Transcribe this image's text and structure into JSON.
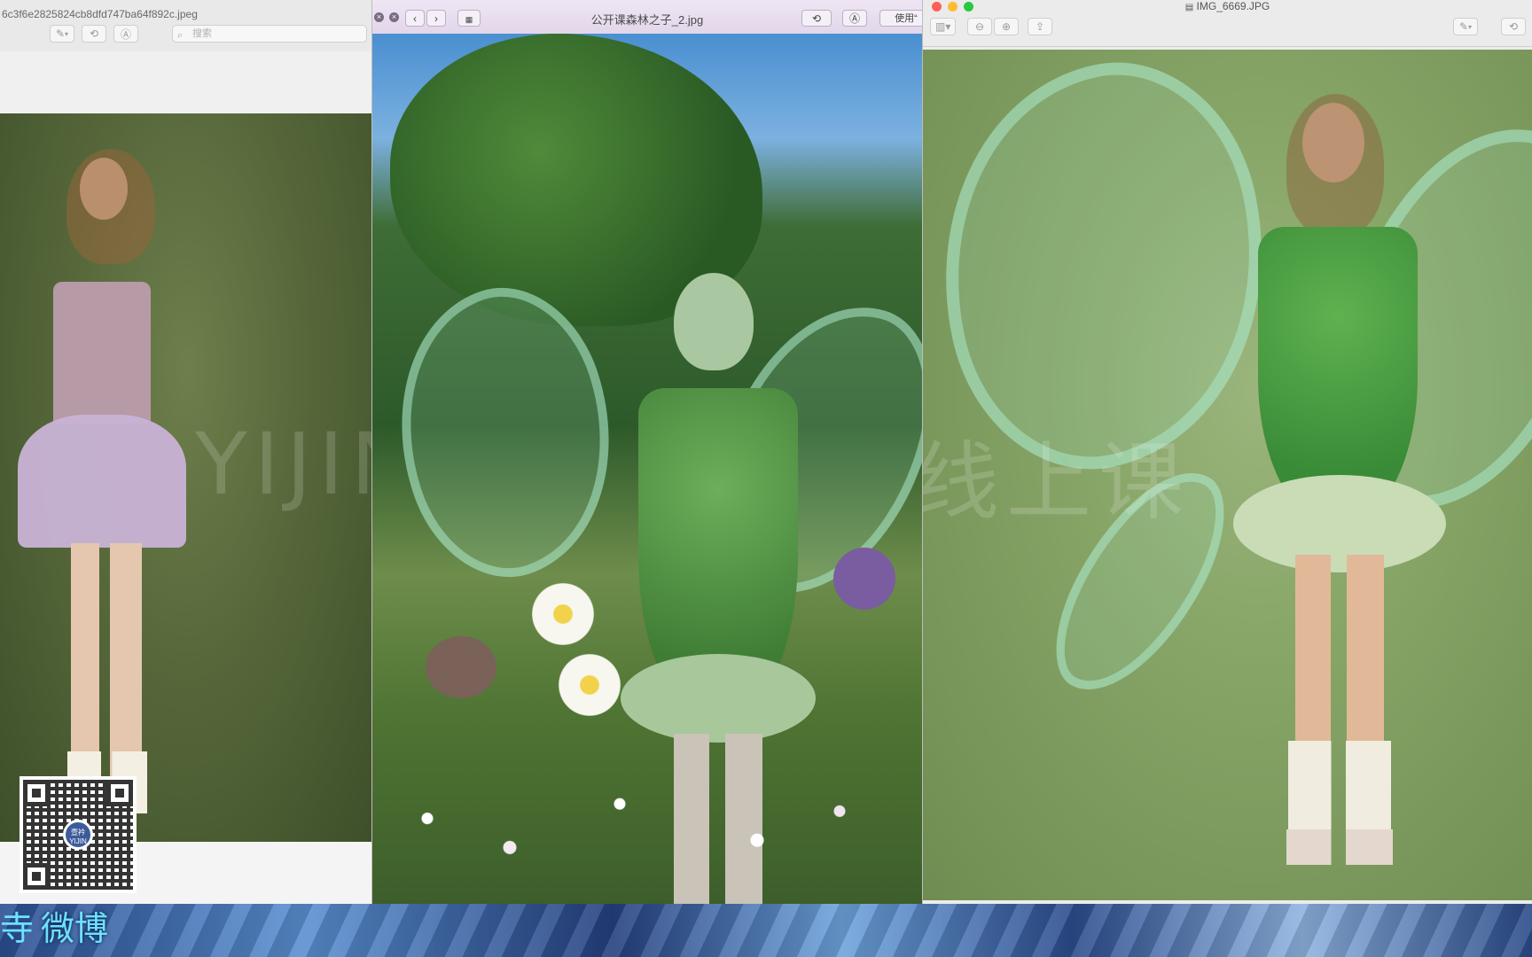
{
  "window_left": {
    "title": "6c3f6e2825824cb8dfd747ba64f892c.jpeg",
    "search_placeholder": "搜索",
    "watermark": "YIJIN"
  },
  "window_middle": {
    "title": "公开课森林之子_2.jpg",
    "use_button_label": "使用“"
  },
  "window_right": {
    "title": "IMG_6669.JPG",
    "watermark": "线上课"
  },
  "overlay": {
    "weibo_label": "微博",
    "weibo_prefix": "寺",
    "qr_logo_text": "壹衿 YIJIN"
  },
  "colors": {
    "accent_cyan": "#6fe0ff",
    "traffic_red": "#ff5f57",
    "traffic_yellow": "#febc2e",
    "traffic_green": "#28c840"
  }
}
